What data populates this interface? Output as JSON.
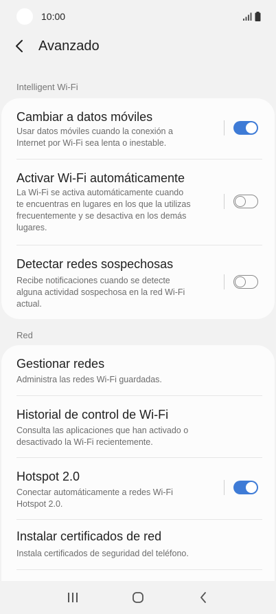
{
  "status_bar": {
    "time": "10:00"
  },
  "header": {
    "title": "Avanzado"
  },
  "sections": [
    {
      "label": "Intelligent Wi-Fi",
      "items": [
        {
          "title": "Cambiar a datos móviles",
          "desc": [
            "Usar datos móviles cuando la conexión a",
            "Internet por Wi-Fi sea lenta o inestable."
          ],
          "toggle": true
        },
        {
          "title": "Activar Wi-Fi automáticamente",
          "desc": [
            "La Wi-Fi se activa automáticamente cuando",
            "te encuentras en lugares en los que la utilizas",
            "frecuentemente y se desactiva en los demás",
            "lugares."
          ],
          "toggle": false
        },
        {
          "title": "Detectar redes sospechosas",
          "desc": [
            "Recibe notificaciones cuando se detecte",
            "alguna actividad sospechosa en la red Wi-Fi",
            "actual."
          ],
          "toggle": false
        }
      ]
    },
    {
      "label": "Red",
      "items": [
        {
          "title": "Gestionar redes",
          "desc": [
            "Administra las redes Wi-Fi guardadas."
          ]
        },
        {
          "title": "Historial de control de Wi-Fi",
          "desc": [
            "Consulta las aplicaciones que han activado o",
            "desactivado la Wi-Fi recientemente."
          ]
        },
        {
          "title": "Hotspot 2.0",
          "desc": [
            "Conectar automáticamente a redes Wi-Fi",
            "Hotspot 2.0."
          ],
          "toggle": true
        },
        {
          "title": "Instalar certificados de red",
          "desc": [
            "Instala certificados de seguridad del teléfono."
          ]
        }
      ]
    }
  ],
  "colors": {
    "accent": "#3e7bd6",
    "background": "#f2f2f2",
    "card": "#fcfcfc"
  },
  "nav_bar": {
    "icons": [
      "recents-icon",
      "home-icon",
      "back-icon"
    ]
  }
}
